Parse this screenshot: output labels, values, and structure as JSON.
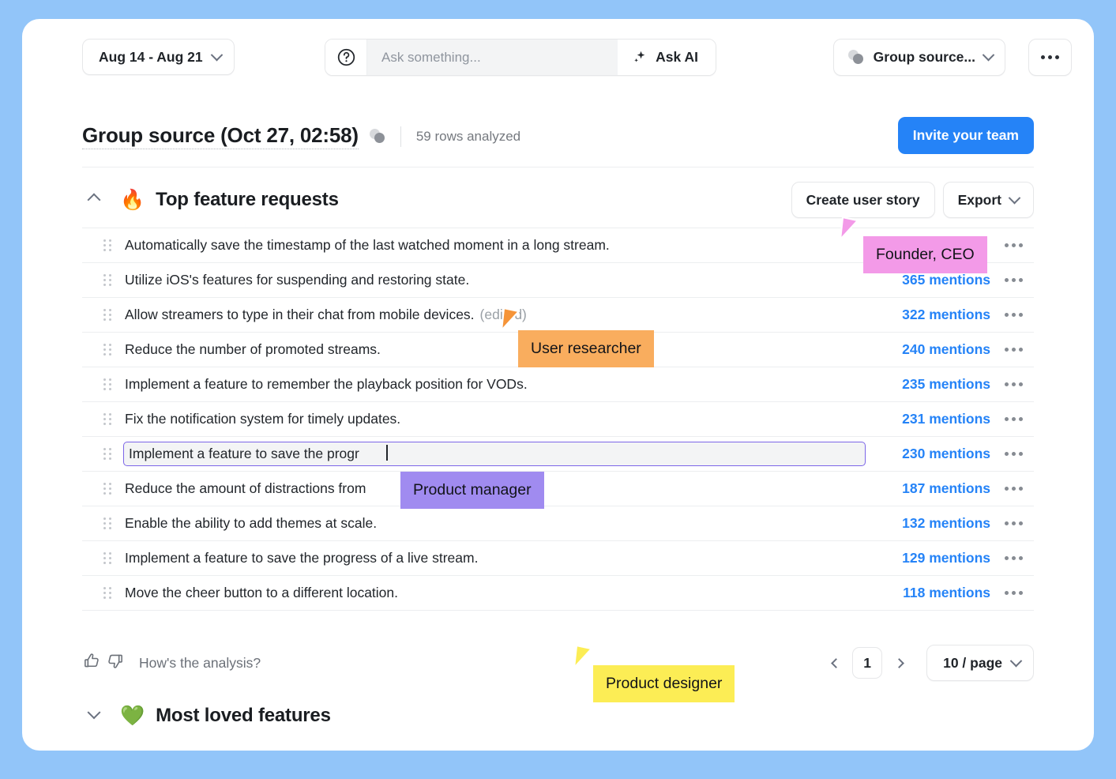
{
  "topbar": {
    "date_range": "Aug 14 - Aug 21",
    "help_icon": "question-circle-icon",
    "ask_placeholder": "Ask something...",
    "ask_value": "",
    "ask_ai_label": "Ask AI",
    "ask_ai_icon": "sparkle-icon",
    "group_source_label": "Group source...",
    "group_source_icon": "overlapping-circles-icon",
    "more_icon": "ellipsis-icon"
  },
  "header": {
    "title": "Group source (Oct 27, 02:58)",
    "title_icon": "overlapping-circles-icon",
    "rows_analyzed": "59 rows analyzed",
    "invite_label": "Invite your team"
  },
  "section": {
    "collapse_icon": "chevron-up-icon",
    "emoji": "🔥",
    "title": "Top feature requests",
    "create_user_story_label": "Create user story",
    "export_label": "Export",
    "export_chevron": "chevron-down-icon"
  },
  "rows": [
    {
      "text": "Automatically save the timestamp of the last watched moment in a long stream.",
      "mentions": "",
      "edited": ""
    },
    {
      "text": "Utilize iOS's features for suspending and restoring state.",
      "mentions": "365 mentions",
      "edited": ""
    },
    {
      "text": "Allow streamers to type in their chat from mobile devices.",
      "mentions": "322 mentions",
      "edited": "(edited)"
    },
    {
      "text": "Reduce the number of promoted streams.",
      "mentions": "240 mentions",
      "edited": ""
    },
    {
      "text": "Implement a feature to remember the playback position for VODs.",
      "mentions": "235 mentions",
      "edited": ""
    },
    {
      "text": "Fix the notification system for timely updates.",
      "mentions": "231 mentions",
      "edited": ""
    },
    {
      "text": "Implement a feature to save the progr",
      "mentions": "230 mentions",
      "edited": "",
      "editing": "true"
    },
    {
      "text": "Reduce the amount of distractions from",
      "mentions": "187 mentions",
      "edited": ""
    },
    {
      "text": "Enable the ability to add themes at scale.",
      "mentions": "132 mentions",
      "edited": ""
    },
    {
      "text": "Implement a feature to save the progress of a live stream.",
      "mentions": "129 mentions",
      "edited": ""
    },
    {
      "text": "Move the cheer button to a different location.",
      "mentions": "118 mentions",
      "edited": ""
    }
  ],
  "footer": {
    "thumbs_up_icon": "thumbs-up-icon",
    "thumbs_down_icon": "thumbs-down-icon",
    "feedback_label": "How's the analysis?",
    "prev_icon": "chevron-left-icon",
    "page_number": "1",
    "next_icon": "chevron-right-icon",
    "per_page": "10 / page",
    "per_page_chevron": "chevron-down-icon"
  },
  "section2": {
    "collapse_icon": "chevron-down-icon",
    "emoji": "💚",
    "title": "Most loved features"
  },
  "annotations": [
    {
      "label": "Founder, CEO",
      "color": "#f39ae8"
    },
    {
      "label": "User researcher",
      "color": "#f9ad5e"
    },
    {
      "label": "Product manager",
      "color": "#a08bf0"
    },
    {
      "label": "Product designer",
      "color": "#fced55"
    }
  ],
  "colors": {
    "page_background": "#92c5f9",
    "accent_blue": "#2583f7",
    "edit_border": "#7c66e8"
  }
}
